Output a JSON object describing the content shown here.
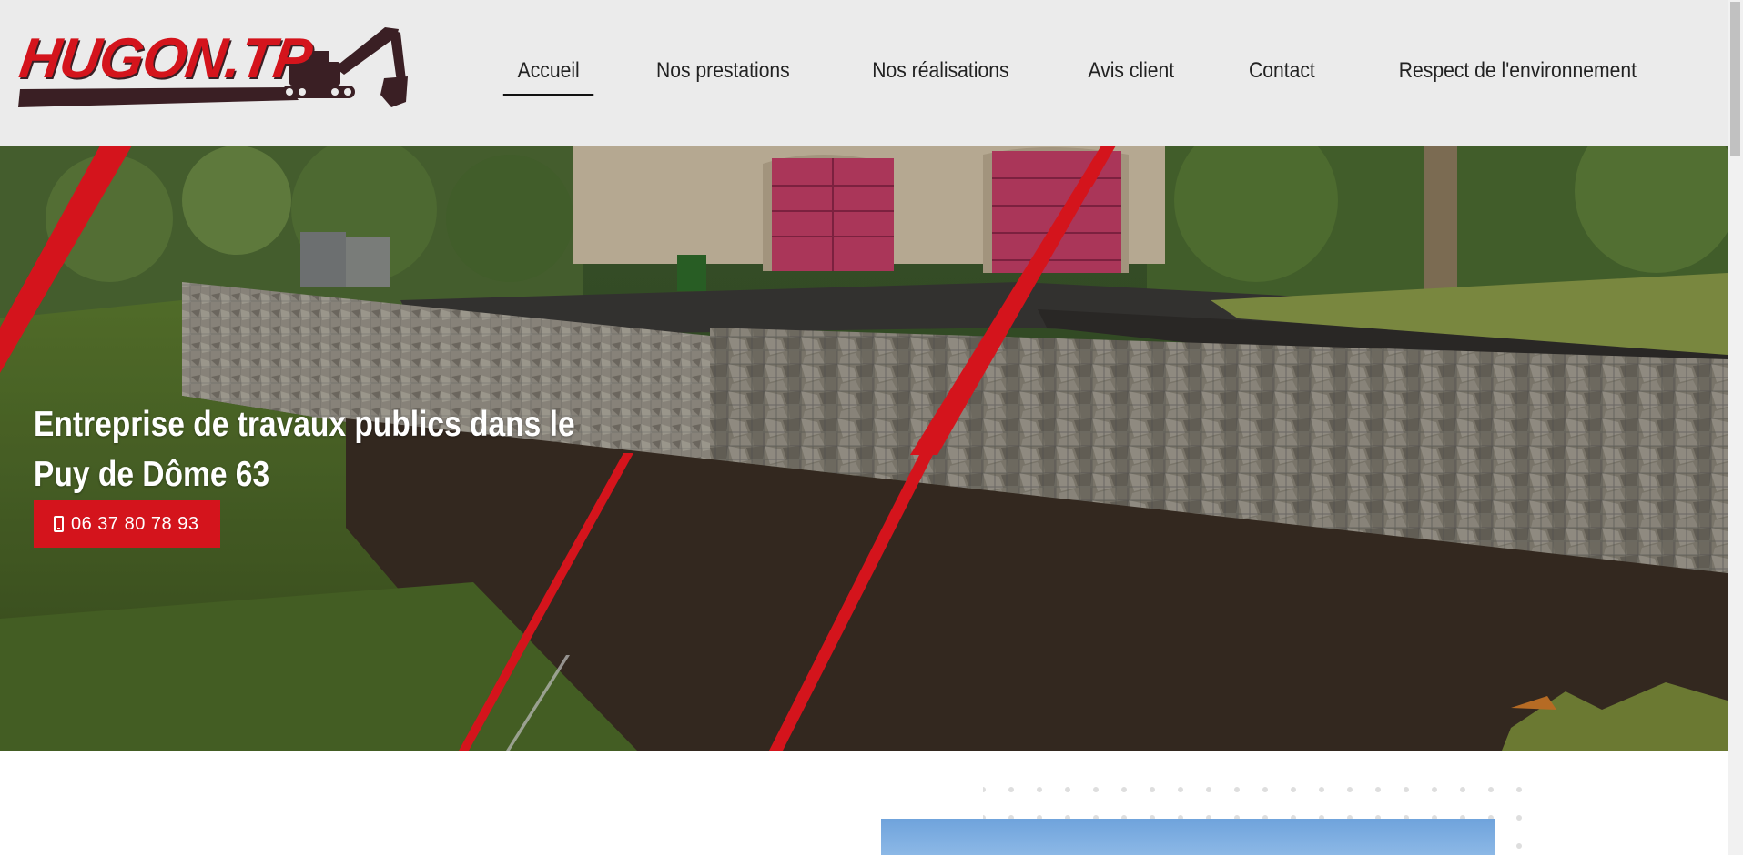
{
  "brand": {
    "logo_text": "HUGON.TP",
    "primary_color": "#d4141c",
    "dark_color": "#3a1f24"
  },
  "nav": {
    "items": [
      {
        "label": "Accueil",
        "active": true
      },
      {
        "label": "Nos prestations",
        "active": false
      },
      {
        "label": "Nos réalisations",
        "active": false
      },
      {
        "label": "Avis client",
        "active": false
      },
      {
        "label": "Contact",
        "active": false
      },
      {
        "label": "Respect de l'environnement",
        "active": false
      }
    ]
  },
  "hero": {
    "title": "Entreprise de travaux publics dans le Puy de Dôme 63",
    "phone_label": "06 37 80 78 93",
    "phone_icon": "mobile-phone-icon"
  }
}
